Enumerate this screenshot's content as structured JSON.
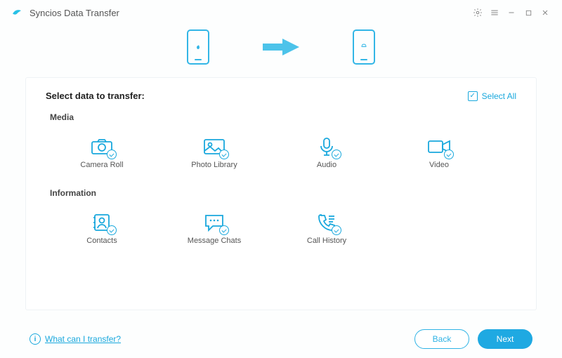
{
  "app": {
    "title": "Syncios Data Transfer"
  },
  "titlebar_icons": {
    "settings": "settings-icon",
    "menu": "menu-icon",
    "minimize": "minimize-icon",
    "maximize": "maximize-icon",
    "close": "close-icon"
  },
  "devices": {
    "source_platform": "ios",
    "target_platform": "android"
  },
  "panel": {
    "heading": "Select data to transfer:",
    "select_all_label": "Select All",
    "select_all_checked": true
  },
  "sections": [
    {
      "title": "Media",
      "items": [
        {
          "key": "camera-roll",
          "label": "Camera Roll",
          "icon": "camera-icon"
        },
        {
          "key": "photo-library",
          "label": "Photo Library",
          "icon": "photo-icon"
        },
        {
          "key": "audio",
          "label": "Audio",
          "icon": "mic-icon"
        },
        {
          "key": "video",
          "label": "Video",
          "icon": "video-icon"
        }
      ]
    },
    {
      "title": "Information",
      "items": [
        {
          "key": "contacts",
          "label": "Contacts",
          "icon": "contacts-icon"
        },
        {
          "key": "message-chats",
          "label": "Message Chats",
          "icon": "message-icon"
        },
        {
          "key": "call-history",
          "label": "Call History",
          "icon": "phone-icon"
        }
      ]
    }
  ],
  "footer": {
    "info_char": "i",
    "help_link": "What can I transfer?",
    "back_label": "Back",
    "next_label": "Next"
  },
  "colors": {
    "accent": "#19a8dd"
  }
}
